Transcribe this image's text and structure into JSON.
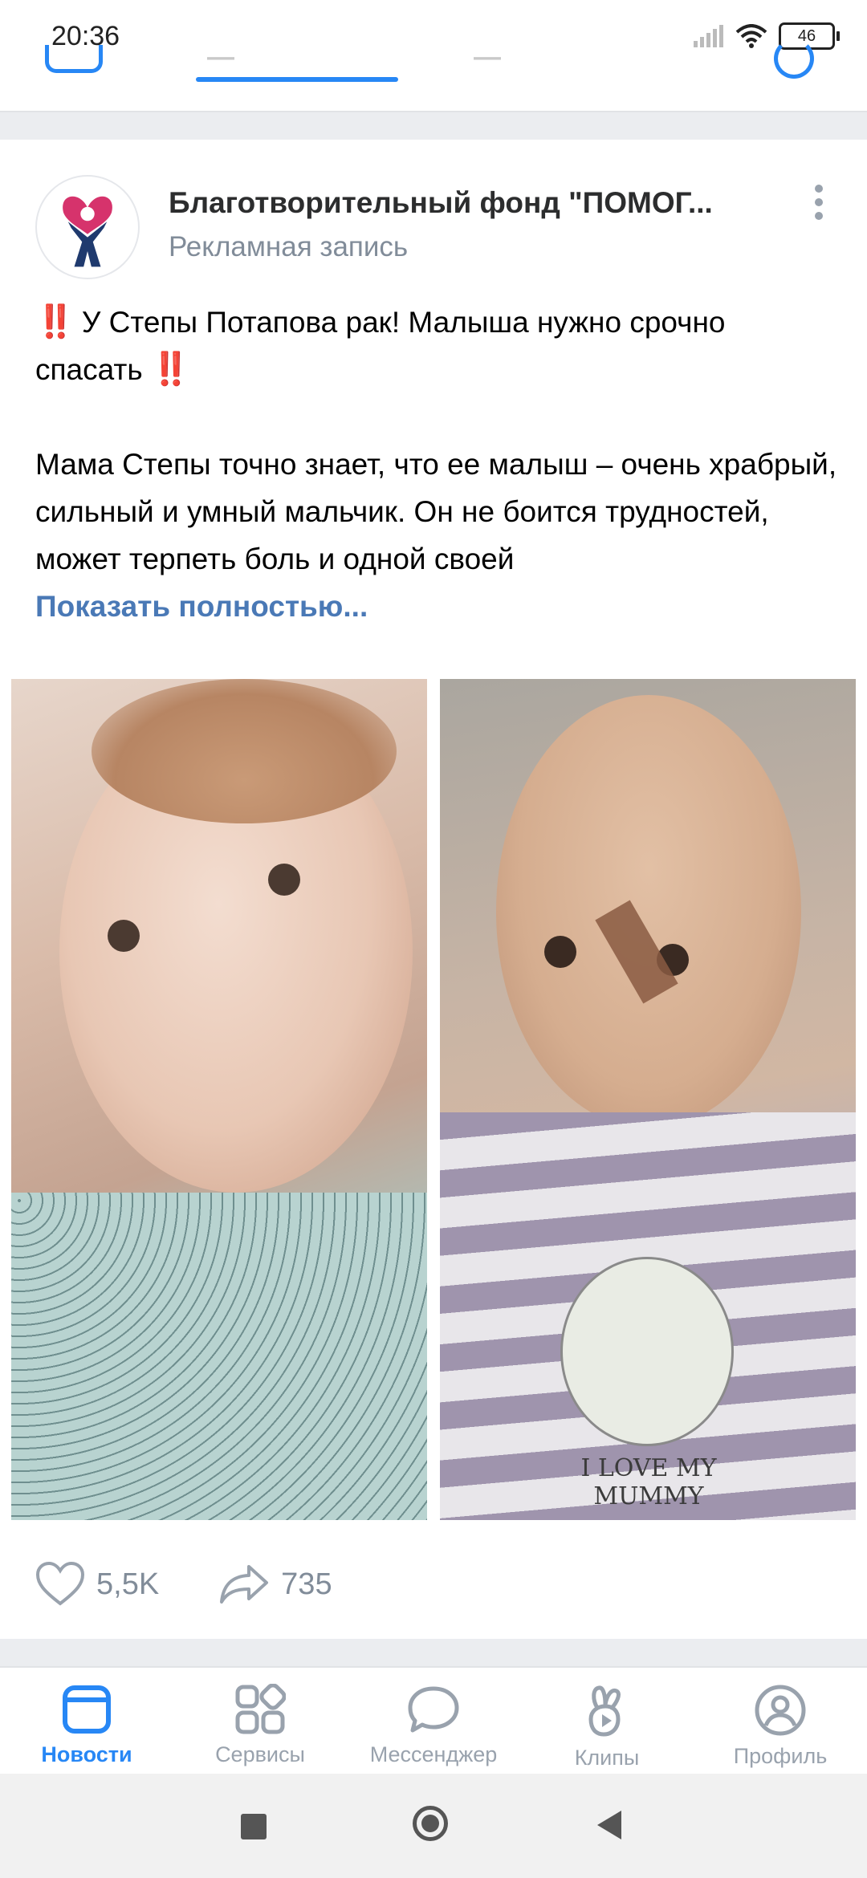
{
  "status_bar": {
    "time": "20:36",
    "battery": "46"
  },
  "post": {
    "author": "Благотворительный фонд \"ПОМОГ...",
    "subtitle": "Рекламная запись",
    "headline": "У Степы Потапова рак! Малыша нужно срочно спасать",
    "headline_emoji": "‼️",
    "body": "Мама Степы точно знает, что ее малыш – очень храбрый, сильный и умный мальчик. Он не боится трудностей, может терпеть боль и одной своей",
    "show_more": "Показать полностью...",
    "photos": [
      {
        "caption_print": ""
      },
      {
        "caption_print": "I LOVE MY MUMMY"
      }
    ],
    "likes": "5,5K",
    "shares": "735"
  },
  "tabbar": {
    "items": [
      {
        "label": "Новости",
        "icon": "news-icon",
        "active": true
      },
      {
        "label": "Сервисы",
        "icon": "services-icon",
        "active": false
      },
      {
        "label": "Мессенджер",
        "icon": "messenger-icon",
        "active": false
      },
      {
        "label": "Клипы",
        "icon": "clips-icon",
        "active": false
      },
      {
        "label": "Профиль",
        "icon": "profile-icon",
        "active": false
      }
    ]
  },
  "colors": {
    "accent": "#2787f5",
    "link": "#4a79b6",
    "secondary_text": "#818c99",
    "alert_red": "#e0262d",
    "logo_pink": "#d6336c",
    "logo_navy": "#1f3a6e"
  }
}
